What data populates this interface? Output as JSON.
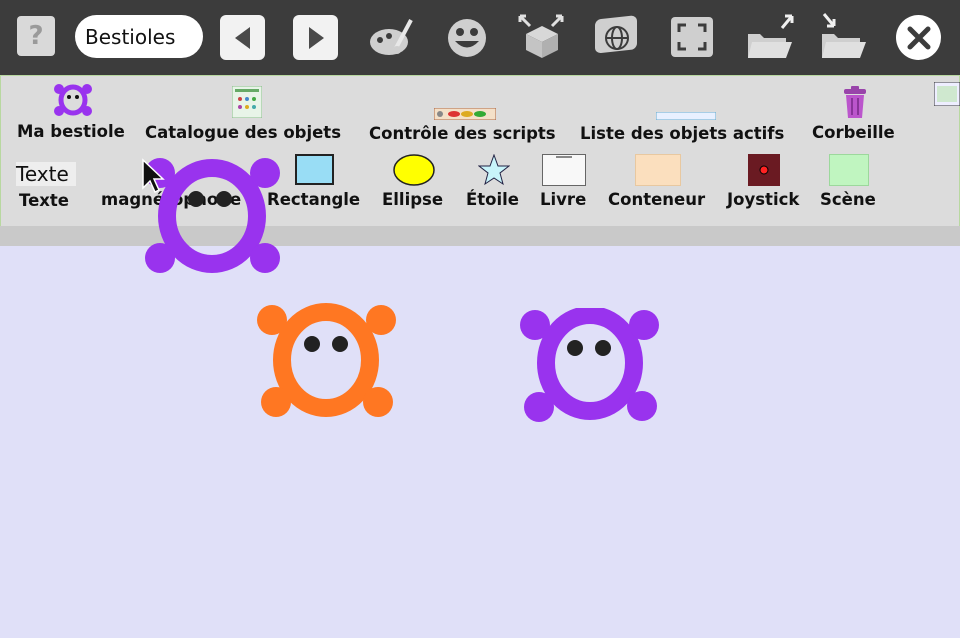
{
  "toolbar": {
    "help_glyph": "?",
    "project_name": "Bestioles",
    "icons": [
      "help-icon",
      "back-icon",
      "forward-icon",
      "paint-icon",
      "smiley-icon",
      "box-icon",
      "globe-icon",
      "fullscreen-icon",
      "open-folder-icon",
      "save-folder-icon",
      "close-icon"
    ]
  },
  "flap": {
    "row1": [
      {
        "label": "Ma bestiole"
      },
      {
        "label": "Catalogue des objets"
      },
      {
        "label": "Contrôle des scripts"
      },
      {
        "label": "Liste des objets actifs"
      },
      {
        "label": "Corbeille"
      }
    ],
    "row2": [
      {
        "label": "Texte",
        "preview": "Texte"
      },
      {
        "label": "magnétophone"
      },
      {
        "label": "Rectangle"
      },
      {
        "label": "Ellipse"
      },
      {
        "label": "Étoile"
      },
      {
        "label": "Livre"
      },
      {
        "label": "Conteneur"
      },
      {
        "label": "Joystick"
      },
      {
        "label": "Scène"
      }
    ]
  },
  "colors": {
    "purple": "#9933ee",
    "orange": "#ff7722",
    "toolbar_bg": "#3c3c3c",
    "world_bg": "#e0e0f8",
    "flap_bg": "#dcdcdc"
  }
}
